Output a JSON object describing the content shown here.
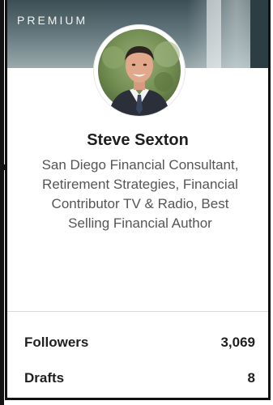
{
  "badge": {
    "label": "PREMIUM"
  },
  "profile": {
    "avatar_icon": "profile-photo",
    "name": "Steve Sexton",
    "headline": "San Diego Financial Consultant, Retirement Strategies, Financial Contributor TV & Radio, Best Selling Financial Author"
  },
  "stats": {
    "followers": {
      "label": "Followers",
      "value": "3,069"
    },
    "drafts": {
      "label": "Drafts",
      "value": "8"
    }
  },
  "colors": {
    "banner_dark": "#3c4e55",
    "banner_light": "#9aaaad",
    "text_primary": "#1f1f1f",
    "text_secondary": "#555555",
    "border": "#121212"
  }
}
